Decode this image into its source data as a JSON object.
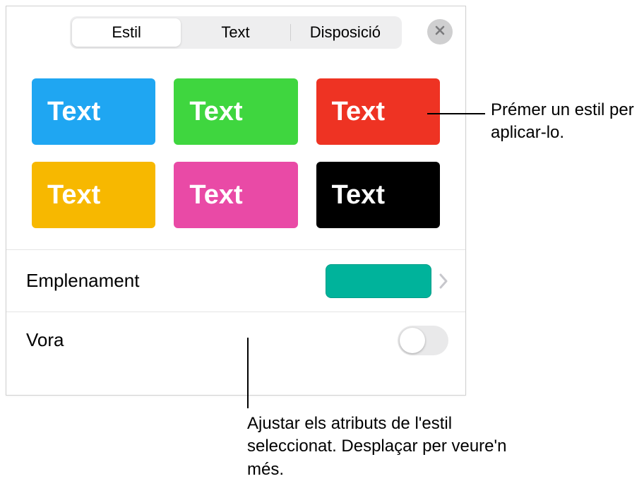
{
  "tabs": {
    "style": "Estil",
    "text": "Text",
    "layout": "Disposició"
  },
  "styles": {
    "label": "Text",
    "swatches": [
      {
        "bg": "#1fa6f2"
      },
      {
        "bg": "#3fd63f"
      },
      {
        "bg": "#ee3323"
      },
      {
        "bg": "#f7b800"
      },
      {
        "bg": "#e94aa6"
      },
      {
        "bg": "#000000"
      }
    ]
  },
  "fill": {
    "label": "Emplenament",
    "color": "#00b39b"
  },
  "border": {
    "label": "Vora",
    "enabled": false
  },
  "callouts": {
    "applyStyle": "Prémer un estil per aplicar-lo.",
    "adjustAttributes": "Ajustar els atributs de l'estil seleccionat. Desplaçar per veure'n més."
  }
}
